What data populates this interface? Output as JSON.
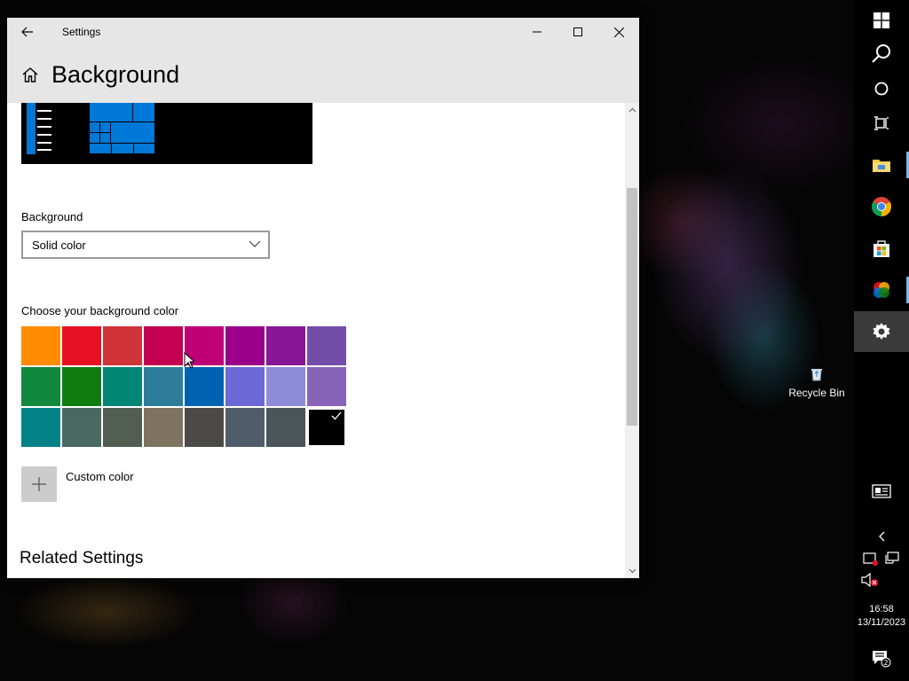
{
  "window": {
    "title": "Settings",
    "page_title": "Background"
  },
  "background_section": {
    "label": "Background",
    "dropdown_value": "Solid color"
  },
  "color_section": {
    "label": "Choose your background color",
    "selected_index": 23,
    "swatches": [
      "#ff8c00",
      "#e81123",
      "#d13438",
      "#c30052",
      "#bf0077",
      "#9a0089",
      "#881798",
      "#744da9",
      "#10893e",
      "#107c10",
      "#018574",
      "#2d7d9a",
      "#0063b1",
      "#6b69d6",
      "#8e8cd8",
      "#8764b8",
      "#038387",
      "#486860",
      "#525e54",
      "#7e735f",
      "#4c4a48",
      "#515c6b",
      "#4a5459",
      "#000000"
    ],
    "custom_color_label": "Custom color"
  },
  "related": {
    "heading": "Related Settings"
  },
  "desktop": {
    "recycle_bin_label": "Recycle Bin"
  },
  "taskbar": {
    "time": "16:58",
    "date": "13/11/2023",
    "notification_count": "2"
  }
}
